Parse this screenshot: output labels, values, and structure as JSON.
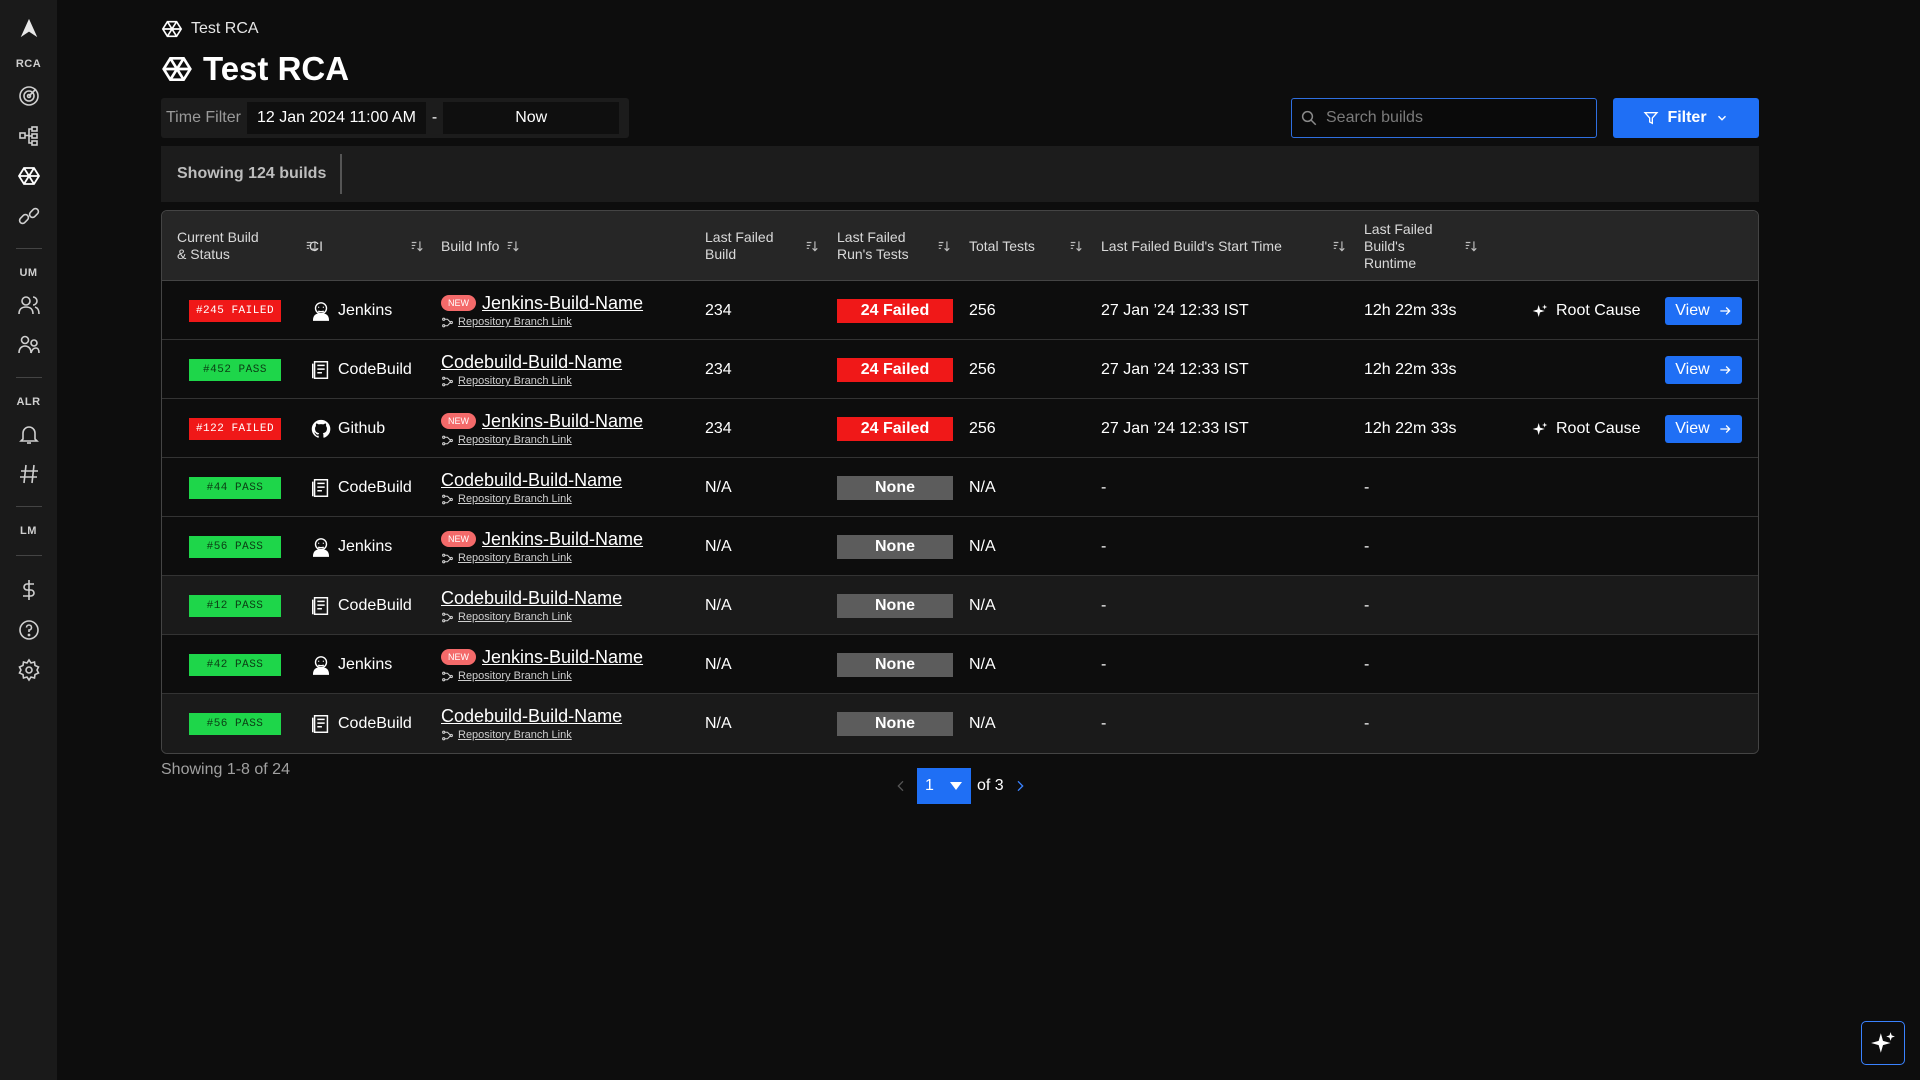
{
  "sidebar": {
    "sections": [
      "RCA",
      "UM",
      "ALR",
      "LM"
    ]
  },
  "breadcrumb": "Test RCA",
  "page_title": "Test RCA",
  "time_filter": {
    "label": "Time Filter",
    "start": "12 Jan 2024 11:00 AM",
    "dash": "-",
    "end": "Now"
  },
  "search": {
    "placeholder": "Search builds"
  },
  "filter_button": "Filter",
  "showing_label": "Showing 124 builds",
  "table": {
    "headers": {
      "current": "Current Build & Status",
      "ci": "CI",
      "build_info": "Build Info",
      "last_failed_build": "Last Failed Build",
      "last_failed_tests": "Last Failed Run's Tests",
      "total_tests": "Total Tests",
      "start_time": "Last Failed Build's Start Time",
      "runtime": "Last Failed Build's Runtime"
    },
    "rows": [
      {
        "status": "#245 FAILED",
        "ci": "Jenkins",
        "new": "NEW",
        "build_name": "Jenkins-Build-Name",
        "repo_link": "Repository Branch Link",
        "last_failed": "234",
        "tests": "24 Failed",
        "total": "256",
        "start": "27 Jan ’24 12:33 IST",
        "runtime": "12h 22m 33s",
        "root_cause": "Root Cause",
        "view": "View"
      },
      {
        "status": "#452 PASS",
        "ci": "CodeBuild",
        "new": "",
        "build_name": "Codebuild-Build-Name",
        "repo_link": "Repository Branch Link",
        "last_failed": "234",
        "tests": "24 Failed",
        "total": "256",
        "start": "27 Jan ’24 12:33 IST",
        "runtime": "12h 22m 33s",
        "root_cause": "",
        "view": "View"
      },
      {
        "status": "#122 FAILED",
        "ci": "Github",
        "new": "NEW",
        "build_name": "Jenkins-Build-Name",
        "repo_link": "Repository Branch Link",
        "last_failed": "234",
        "tests": "24 Failed",
        "total": "256",
        "start": "27 Jan ’24 12:33 IST",
        "runtime": "12h 22m 33s",
        "root_cause": "Root Cause",
        "view": "View"
      },
      {
        "status": "#44 PASS",
        "ci": "CodeBuild",
        "new": "",
        "build_name": "Codebuild-Build-Name",
        "repo_link": "Repository Branch Link",
        "last_failed": "N/A",
        "tests": "None",
        "total": "N/A",
        "start": "-",
        "runtime": "-",
        "root_cause": "",
        "view": ""
      },
      {
        "status": "#56 PASS",
        "ci": "Jenkins",
        "new": "NEW",
        "build_name": "Jenkins-Build-Name",
        "repo_link": "Repository Branch Link",
        "last_failed": "N/A",
        "tests": "None",
        "total": "N/A",
        "start": "-",
        "runtime": "-",
        "root_cause": "",
        "view": ""
      },
      {
        "status": "#12 PASS",
        "ci": "CodeBuild",
        "new": "",
        "build_name": "Codebuild-Build-Name",
        "repo_link": "Repository Branch Link",
        "last_failed": "N/A",
        "tests": "None",
        "total": "N/A",
        "start": "-",
        "runtime": "-",
        "root_cause": "",
        "view": ""
      },
      {
        "status": "#42 PASS",
        "ci": "Jenkins",
        "new": "NEW",
        "build_name": "Jenkins-Build-Name",
        "repo_link": "Repository Branch Link",
        "last_failed": "N/A",
        "tests": "None",
        "total": "N/A",
        "start": "-",
        "runtime": "-",
        "root_cause": "",
        "view": ""
      },
      {
        "status": "#56 PASS",
        "ci": "CodeBuild",
        "new": "",
        "build_name": "Codebuild-Build-Name",
        "repo_link": "Repository Branch Link",
        "last_failed": "N/A",
        "tests": "None",
        "total": "N/A",
        "start": "-",
        "runtime": "-",
        "root_cause": "",
        "view": ""
      }
    ]
  },
  "footer": {
    "count": "Showing 1-8 of 24",
    "page": "1",
    "of": "of 3"
  },
  "colors": {
    "accent": "#1f6ff5",
    "failed": "#f01818",
    "pass": "#1ed64a",
    "none": "#5c5c5c"
  }
}
